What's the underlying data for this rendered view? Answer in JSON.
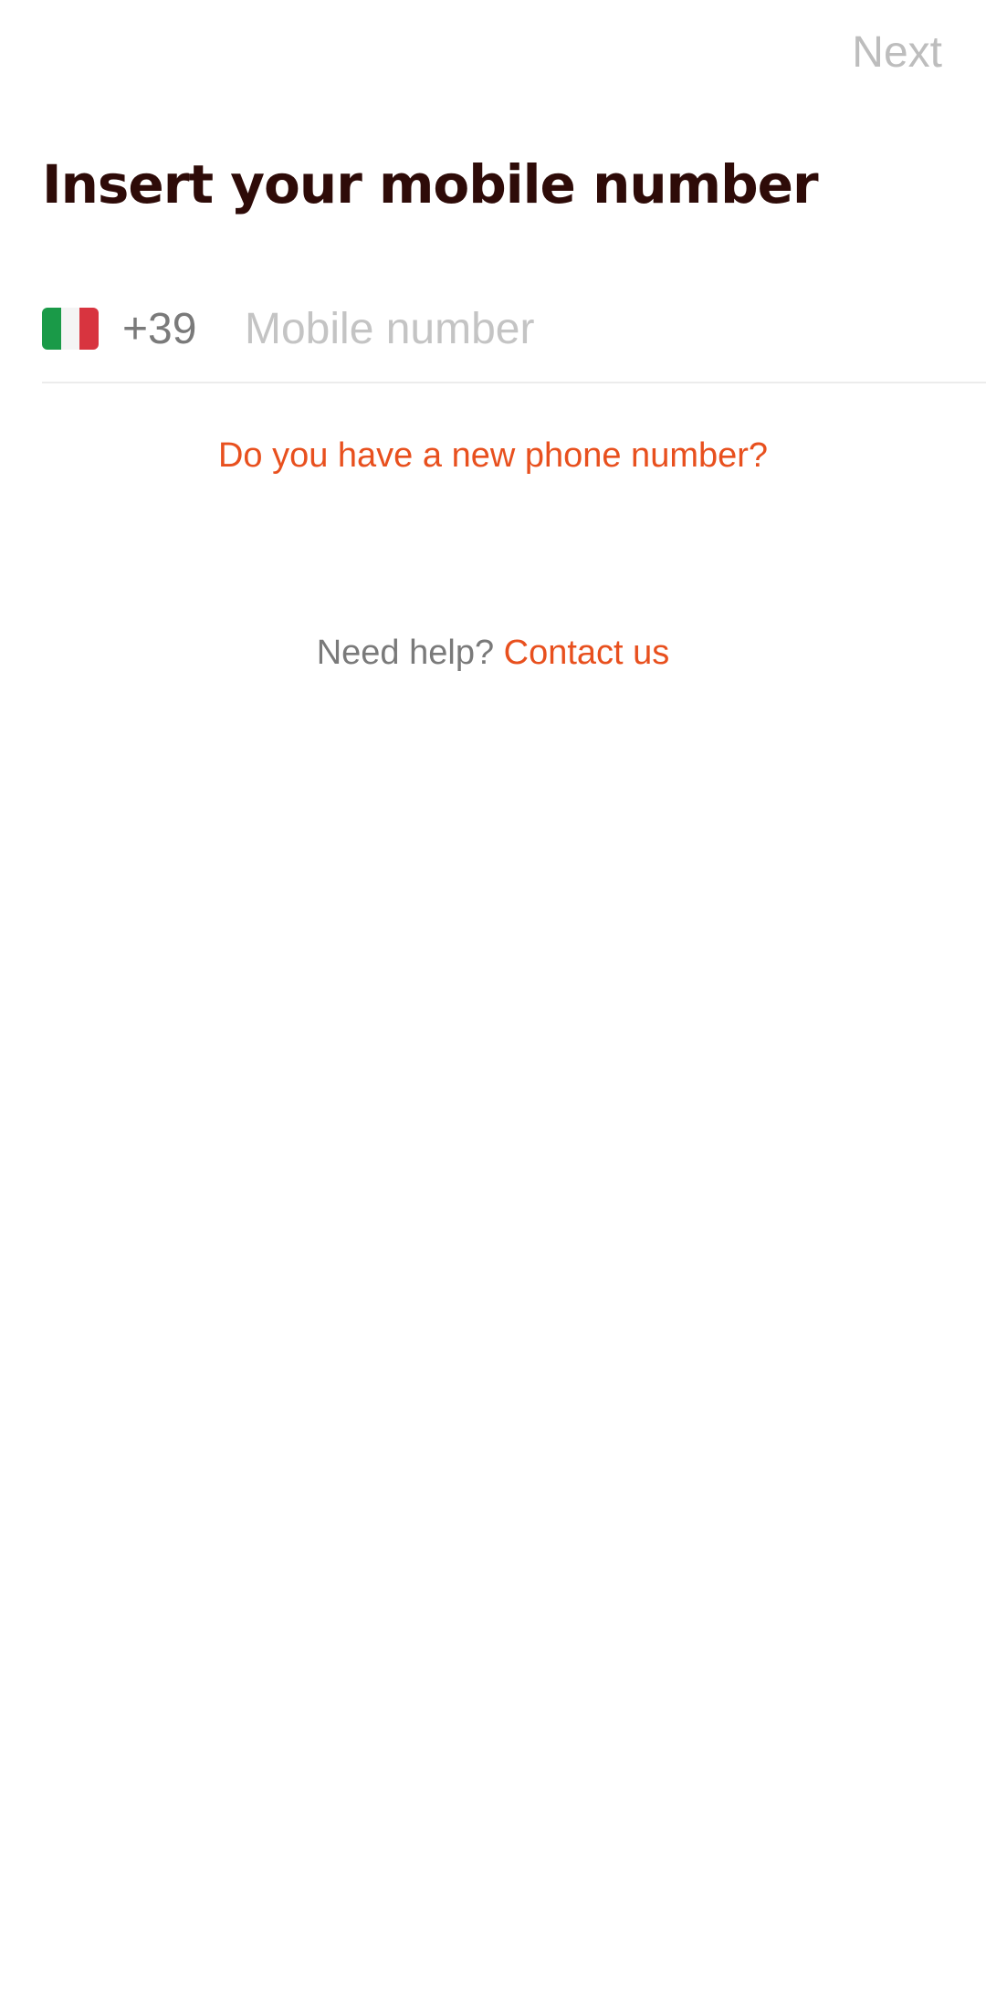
{
  "header": {
    "next_label": "Next"
  },
  "page": {
    "title": "Insert your mobile number"
  },
  "phone": {
    "country_flag": "italy-flag",
    "flag_colors": [
      "#1a9a48",
      "#f4f4f4",
      "#d8343f"
    ],
    "country_code": "+39",
    "value": "",
    "placeholder": "Mobile number"
  },
  "links": {
    "new_number": "Do you have a new phone number?",
    "help_prefix": "Need help?",
    "contact": "Contact us"
  },
  "colors": {
    "accent": "#e8501e",
    "title": "#2e0b08",
    "muted": "#7a7a7a",
    "disabled": "#bdbdbd"
  }
}
